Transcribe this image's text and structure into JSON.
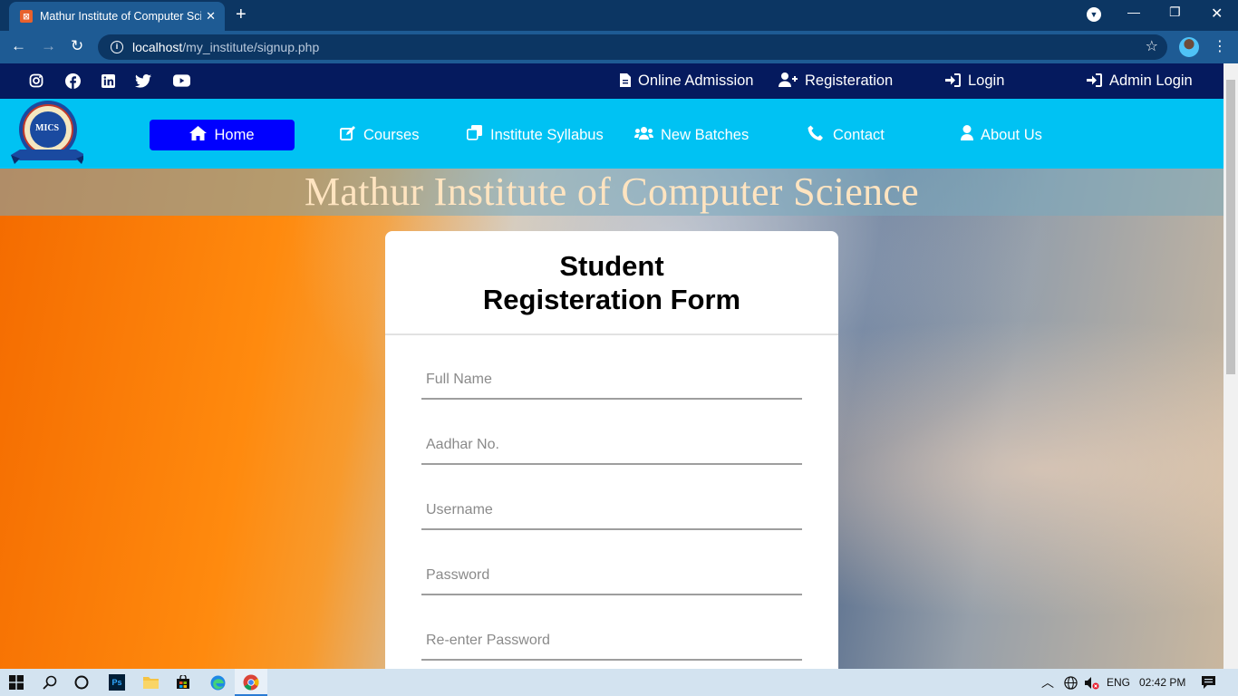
{
  "browser": {
    "tab_title": "Mathur Institute of Computer Science",
    "tab_close": "✕",
    "new_tab": "+",
    "url_host": "localhost",
    "url_path": "/my_institute/signup.php"
  },
  "topbar": {
    "social": [
      "instagram-icon",
      "facebook-icon",
      "linkedin-icon",
      "twitter-icon",
      "youtube-icon"
    ],
    "links": [
      {
        "label": "Online Admission",
        "icon": "document-icon"
      },
      {
        "label": "Registeration",
        "icon": "user-plus-icon"
      },
      {
        "label": "Login",
        "icon": "sign-in-icon"
      },
      {
        "label": "Admin Login",
        "icon": "sign-in-icon"
      }
    ]
  },
  "nav": {
    "logo_text": "MICS",
    "items": [
      {
        "label": "Home",
        "icon": "home-icon",
        "active": true
      },
      {
        "label": "Courses",
        "icon": "edit-icon"
      },
      {
        "label": "Institute Syllabus",
        "icon": "copy-icon"
      },
      {
        "label": "New Batches",
        "icon": "users-icon"
      },
      {
        "label": "Contact",
        "icon": "phone-icon"
      },
      {
        "label": "About Us",
        "icon": "user-icon"
      }
    ]
  },
  "banner": {
    "title": "Mathur Institute of Computer Science"
  },
  "form": {
    "title_line1": "Student",
    "title_line2": "Registeration Form",
    "fields": [
      {
        "placeholder": "Full Name"
      },
      {
        "placeholder": "Aadhar No."
      },
      {
        "placeholder": "Username"
      },
      {
        "placeholder": "Password"
      },
      {
        "placeholder": "Re-enter Password"
      }
    ]
  },
  "taskbar": {
    "language": "ENG",
    "time": "02:42 PM"
  },
  "colors": {
    "topbar": "#051a5e",
    "nav": "#00c2f3",
    "active_nav": "#0000ff"
  }
}
